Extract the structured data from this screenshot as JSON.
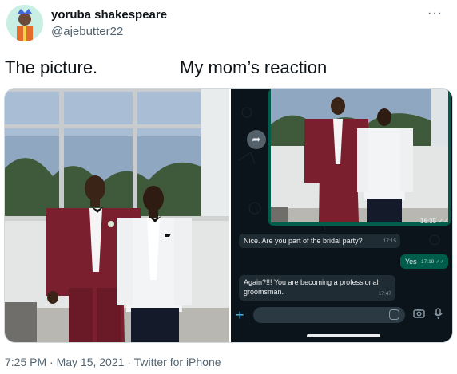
{
  "tweet": {
    "display_name": "yoruba shakespeare",
    "handle": "@ajebutter22",
    "more_icon": "ellipsis-icon",
    "caption_left": "The picture.",
    "caption_right": "My mom’s reaction",
    "footer": "7:25 PM · May 15, 2021 · Twitter for iPhone"
  },
  "whatsapp": {
    "image_time": "16:35 ✓✓",
    "messages": [
      {
        "text": "Nice. Are you part of the bridal party?",
        "time": "17:15",
        "direction": "in"
      },
      {
        "text": "Yes",
        "time": "17:19 ✓✓",
        "direction": "out"
      },
      {
        "text": "Again?!!! You are becoming a professional groomsman.",
        "time": "17:47",
        "direction": "in"
      }
    ],
    "plus_icon": "plus-icon",
    "sticker_icon": "sticker-icon",
    "camera_icon": "camera-icon",
    "mic_icon": "mic-icon",
    "forward_icon": "forward-icon"
  },
  "colors": {
    "wa_background": "#0b141a",
    "wa_incoming": "#202c33",
    "wa_outgoing": "#005c4b",
    "maroon_suit": "#7a1f2e",
    "white_suit": "#f2f4f6"
  }
}
